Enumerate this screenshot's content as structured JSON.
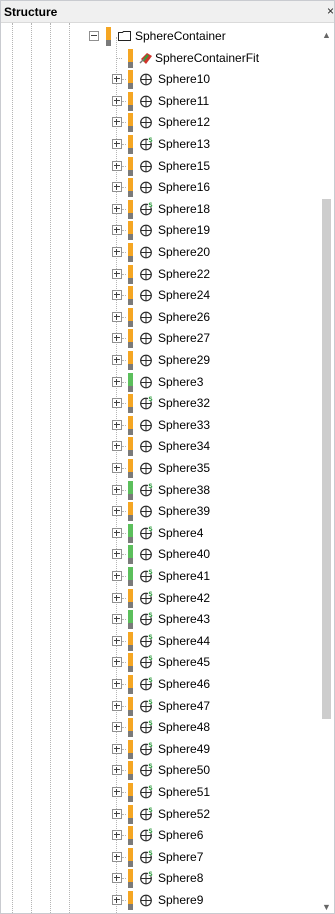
{
  "panel": {
    "title": "Structure",
    "close_glyph": "×",
    "scroll_up_glyph": "▲",
    "scroll_down_glyph": "▼"
  },
  "colors": {
    "status_orange": "#f5a623",
    "status_gray": "#7a7a7a",
    "status_green": "#5cbf5c",
    "modified_badge": "#2e9a3e"
  },
  "tree": {
    "root": {
      "label": "SphereContainer",
      "icon": "folder-icon",
      "expanded": true
    },
    "fit": {
      "label": "SphereContainerFit",
      "icon": "container-fit-icon",
      "status": "orange"
    },
    "items": [
      {
        "label": "Sphere10",
        "status": "orange",
        "modified": false
      },
      {
        "label": "Sphere11",
        "status": "orange",
        "modified": false
      },
      {
        "label": "Sphere12",
        "status": "orange",
        "modified": false
      },
      {
        "label": "Sphere13",
        "status": "orange",
        "modified": true
      },
      {
        "label": "Sphere15",
        "status": "orange",
        "modified": false
      },
      {
        "label": "Sphere16",
        "status": "orange",
        "modified": false
      },
      {
        "label": "Sphere18",
        "status": "orange",
        "modified": true
      },
      {
        "label": "Sphere19",
        "status": "orange",
        "modified": false
      },
      {
        "label": "Sphere20",
        "status": "orange",
        "modified": false
      },
      {
        "label": "Sphere22",
        "status": "orange",
        "modified": false
      },
      {
        "label": "Sphere24",
        "status": "orange",
        "modified": false
      },
      {
        "label": "Sphere26",
        "status": "orange",
        "modified": false
      },
      {
        "label": "Sphere27",
        "status": "orange",
        "modified": false
      },
      {
        "label": "Sphere29",
        "status": "orange",
        "modified": false
      },
      {
        "label": "Sphere3",
        "status": "green",
        "modified": false
      },
      {
        "label": "Sphere32",
        "status": "orange",
        "modified": true
      },
      {
        "label": "Sphere33",
        "status": "orange",
        "modified": false
      },
      {
        "label": "Sphere34",
        "status": "orange",
        "modified": false
      },
      {
        "label": "Sphere35",
        "status": "orange",
        "modified": false
      },
      {
        "label": "Sphere38",
        "status": "green",
        "modified": true
      },
      {
        "label": "Sphere39",
        "status": "orange",
        "modified": false
      },
      {
        "label": "Sphere4",
        "status": "green",
        "modified": true
      },
      {
        "label": "Sphere40",
        "status": "green",
        "modified": false
      },
      {
        "label": "Sphere41",
        "status": "green",
        "modified": true
      },
      {
        "label": "Sphere42",
        "status": "orange",
        "modified": true
      },
      {
        "label": "Sphere43",
        "status": "green",
        "modified": true
      },
      {
        "label": "Sphere44",
        "status": "orange",
        "modified": true
      },
      {
        "label": "Sphere45",
        "status": "orange",
        "modified": true
      },
      {
        "label": "Sphere46",
        "status": "orange",
        "modified": true
      },
      {
        "label": "Sphere47",
        "status": "orange",
        "modified": true
      },
      {
        "label": "Sphere48",
        "status": "orange",
        "modified": true
      },
      {
        "label": "Sphere49",
        "status": "orange",
        "modified": true
      },
      {
        "label": "Sphere50",
        "status": "orange",
        "modified": true
      },
      {
        "label": "Sphere51",
        "status": "orange",
        "modified": true
      },
      {
        "label": "Sphere52",
        "status": "orange",
        "modified": true
      },
      {
        "label": "Sphere6",
        "status": "orange",
        "modified": true
      },
      {
        "label": "Sphere7",
        "status": "orange",
        "modified": true
      },
      {
        "label": "Sphere8",
        "status": "orange",
        "modified": true
      },
      {
        "label": "Sphere9",
        "status": "orange",
        "modified": false
      }
    ]
  }
}
